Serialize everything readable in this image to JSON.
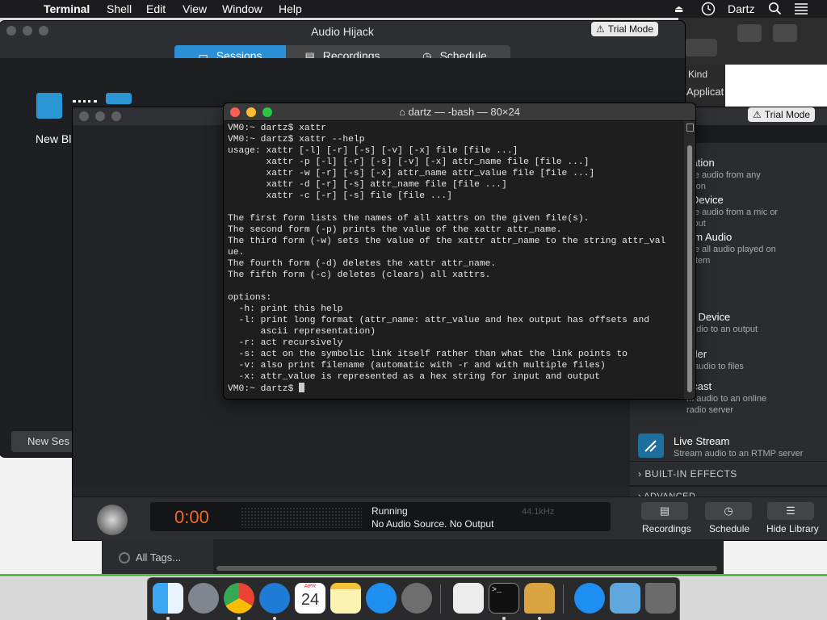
{
  "menubar": {
    "apple": "",
    "app": "Terminal",
    "items": [
      "Shell",
      "Edit",
      "View",
      "Window",
      "Help"
    ],
    "user": "Dartz"
  },
  "audio_hijack": {
    "title": "Audio Hijack",
    "trial": "Trial Mode",
    "tabs": [
      "Sessions",
      "Recordings",
      "Schedule"
    ],
    "new_bl": "New Bl",
    "new_session": "New Ses"
  },
  "session_window": {
    "trial": "Trial Mode",
    "library": {
      "sources": [
        {
          "title": "cation",
          "sub1": "ure audio from any",
          "sub2": "ation"
        },
        {
          "title": "Device",
          "sub1": "ure audio from a mic or",
          "sub2": "input"
        },
        {
          "title": "em Audio",
          "sub1": "ure all audio played on",
          "sub2": "ystem"
        }
      ],
      "outputs": [
        {
          "title": "ut Device",
          "sub1": "audio to an output",
          "sub2": ""
        },
        {
          "title": "rder",
          "sub1": "d audio to files",
          "sub2": ""
        },
        {
          "title": "dcast",
          "sub1": "m audio to an online",
          "sub2": "radio server"
        },
        {
          "title": "Live Stream",
          "sub1": "Stream audio to an RTMP server",
          "sub2": ""
        }
      ],
      "builtin_effects": "BUILT-IN EFFECTS",
      "advanced": "ADVANCED"
    },
    "transport": {
      "timer": "0:00",
      "status": "Running",
      "source_status": "No Audio Source. No Output",
      "samplerate": "44.1kHz",
      "buttons": [
        "Recordings",
        "Schedule",
        "Hide Library"
      ]
    }
  },
  "finder": {
    "kind": "Kind",
    "app": "Applicat"
  },
  "tags": {
    "all_tags": "All Tags..."
  },
  "terminal": {
    "title": "dartz — -bash — 80×24",
    "lines": "VM0:~ dartz$ xattr\nVM0:~ dartz$ xattr --help\nusage: xattr [-l] [-r] [-s] [-v] [-x] file [file ...]\n       xattr -p [-l] [-r] [-s] [-v] [-x] attr_name file [file ...]\n       xattr -w [-r] [-s] [-x] attr_name attr_value file [file ...]\n       xattr -d [-r] [-s] attr_name file [file ...]\n       xattr -c [-r] [-s] file [file ...]\n\nThe first form lists the names of all xattrs on the given file(s).\nThe second form (-p) prints the value of the xattr attr_name.\nThe third form (-w) sets the value of the xattr attr_name to the string attr_val\nue.\nThe fourth form (-d) deletes the xattr attr_name.\nThe fifth form (-c) deletes (clears) all xattrs.\n\noptions:\n  -h: print this help\n  -l: print long format (attr_name: attr_value and hex output has offsets and\n      ascii representation)\n  -r: act recursively\n  -s: act on the symbolic link itself rather than what the link points to\n  -v: also print filename (automatic with -r and with multiple files)\n  -x: attr_value is represented as a hex string for input and output\n",
    "prompt": "VM0:~ dartz$ "
  },
  "dock": {
    "calendar_month": "APR",
    "calendar_day": "24",
    "icons": [
      "finder-icon",
      "launchpad-icon",
      "chrome-icon",
      "safari-icon",
      "calendar-icon",
      "notes-icon",
      "app-store-icon",
      "system-preferences-icon",
      "textedit-icon",
      "terminal-icon",
      "audio-hijack-icon",
      "app-store-icon-2",
      "folder-icon",
      "trash-icon"
    ]
  }
}
